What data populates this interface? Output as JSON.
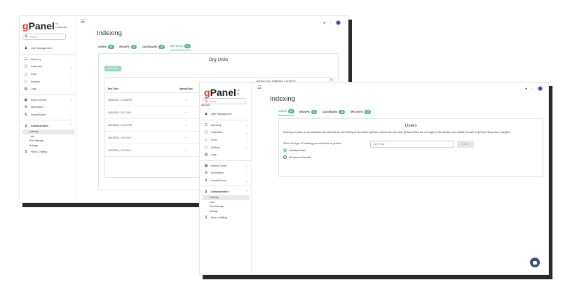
{
  "brand": {
    "name_g": "g",
    "name_rest": "Panel",
    "tm": "™",
    "sub": "by Metrostar"
  },
  "search_placeholder": "Search...",
  "nav": {
    "user_management": "User Management",
    "directory": "Directory",
    "calendars": "Calendars",
    "drive": "Drive",
    "devices": "Devices",
    "logs": "Logs",
    "report_center": "Report Center",
    "automation": "Automation",
    "import_export": "Import/Export",
    "administrative": "Administrative",
    "sub_indexing": "Indexing",
    "sub_labs": "Labs",
    "sub_role_manager": "Role Manager",
    "sub_settings": "Settings",
    "plans_billing": "Plans & Billing"
  },
  "page_title": "Indexing",
  "tabs": {
    "users": "USERS",
    "users_count": "44",
    "groups": "GROUPS",
    "groups_count": "21",
    "calendars": "CALENDARS",
    "calendars_count": "18",
    "org_units": "ORG UNITS",
    "org_units_count": "24"
  },
  "org_units": {
    "title": "Org Units",
    "index_all": "INDEX ALL",
    "last_run": "Last Run Time: 10/28/2024, 1:10:58 PM",
    "col_run_time": "Run Time",
    "col_manual_run": "Manual Run",
    "rows": [
      {
        "run_time": "10/28/2024, 1:30:58 PM",
        "manual": "×"
      },
      {
        "run_time": "10/25/2024, 10:17:15 A...",
        "manual": "×"
      },
      {
        "run_time": "10/23/2024, 1:31:10 PM",
        "manual": "×"
      },
      {
        "run_time": "10/23/2024, 12:57:44 P...",
        "manual": "×"
      },
      {
        "run_time": "10/22/2024, 10:11:50 A...",
        "manual": "×"
      }
    ]
  },
  "users_panel": {
    "title": "Users",
    "description": "Running an index on an individual user will add the user if they do not exist in gPanel, remove the user from gPanel if they are no longer in the domain, and update the user in gPanel if they have changed.",
    "select_label": "Select the type of indexing you would like to perform:",
    "option_individual": "Individual User",
    "option_all": "All Users in Domain",
    "email_placeholder": "User email",
    "submit": "SUBMIT"
  },
  "colors": {
    "accent": "#4cb883",
    "brand_red": "#e5332a",
    "chat": "#3e4f80"
  }
}
